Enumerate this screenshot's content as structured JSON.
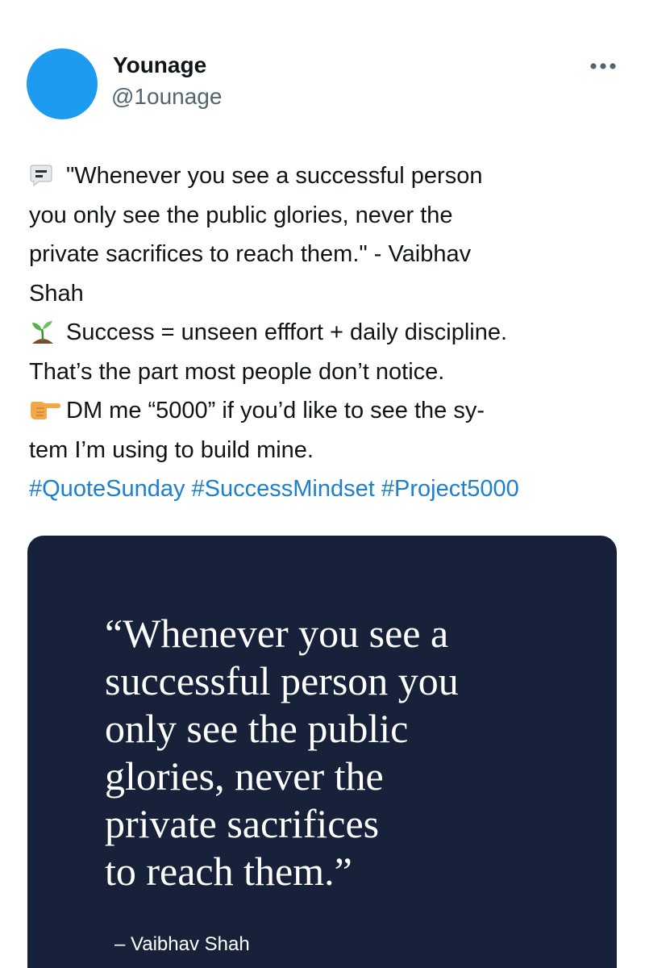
{
  "author": {
    "display_name": "Younage",
    "handle": "@1ounage"
  },
  "post": {
    "lines": [
      "\"Whenever you see a successful person",
      "you only see the public glories, never the",
      "private sacrifices to reach them.\" - Vaibhav",
      "Shah",
      "Success = unseen efffort + daily discipline.",
      "That’s the part most people don’t notice.",
      "DM me “5000” if you’d like to see the sy-",
      "tem I’m using to build mine."
    ],
    "hashtags": [
      "#QuoteSunday",
      "#SuccessMindset",
      "#Project5000"
    ],
    "icons": [
      "speech-bubble-icon",
      "seedling-icon",
      "pointing-finger-icon",
      "more-options-icon"
    ]
  },
  "media": {
    "quote_lines": [
      "“Whenever you see a",
      "successful person you",
      "only see the public",
      "glories, never the",
      "private sacrifices",
      "to reach them.”"
    ],
    "attribution": "– Vaibhav Shah"
  },
  "colors": {
    "avatar": "#1d9bf0",
    "hashtag": "#1d7fcf",
    "card_background": "#17223a",
    "secondary_text": "#536471"
  }
}
